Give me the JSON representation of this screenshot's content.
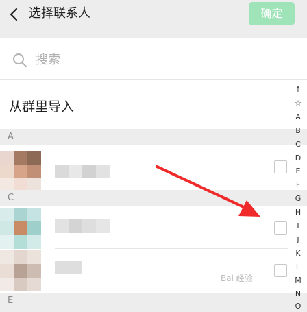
{
  "header": {
    "title": "选择联系人",
    "confirm_label": "确定",
    "back_icon": "chevron-left-icon"
  },
  "search": {
    "placeholder": "搜索",
    "icon": "search-icon"
  },
  "group_import": {
    "label": "从群里导入"
  },
  "sections": [
    {
      "letter": "A"
    },
    {
      "letter": "C"
    },
    {
      "letter": "E"
    }
  ],
  "contacts": [
    {
      "section": "A",
      "checked": false
    },
    {
      "section": "C",
      "checked": false
    },
    {
      "section": "C",
      "checked": false
    }
  ],
  "index_bar": [
    "↑",
    "☆",
    "A",
    "B",
    "C",
    "D",
    "E",
    "F",
    "G",
    "H",
    "I",
    "J",
    "K",
    "L",
    "M",
    "N",
    "O"
  ],
  "watermark": "Bai 经验",
  "colors": {
    "header_bg": "#ededed",
    "confirm_bg": "#9fe3b9",
    "annotation_arrow": "#f02a2a"
  }
}
